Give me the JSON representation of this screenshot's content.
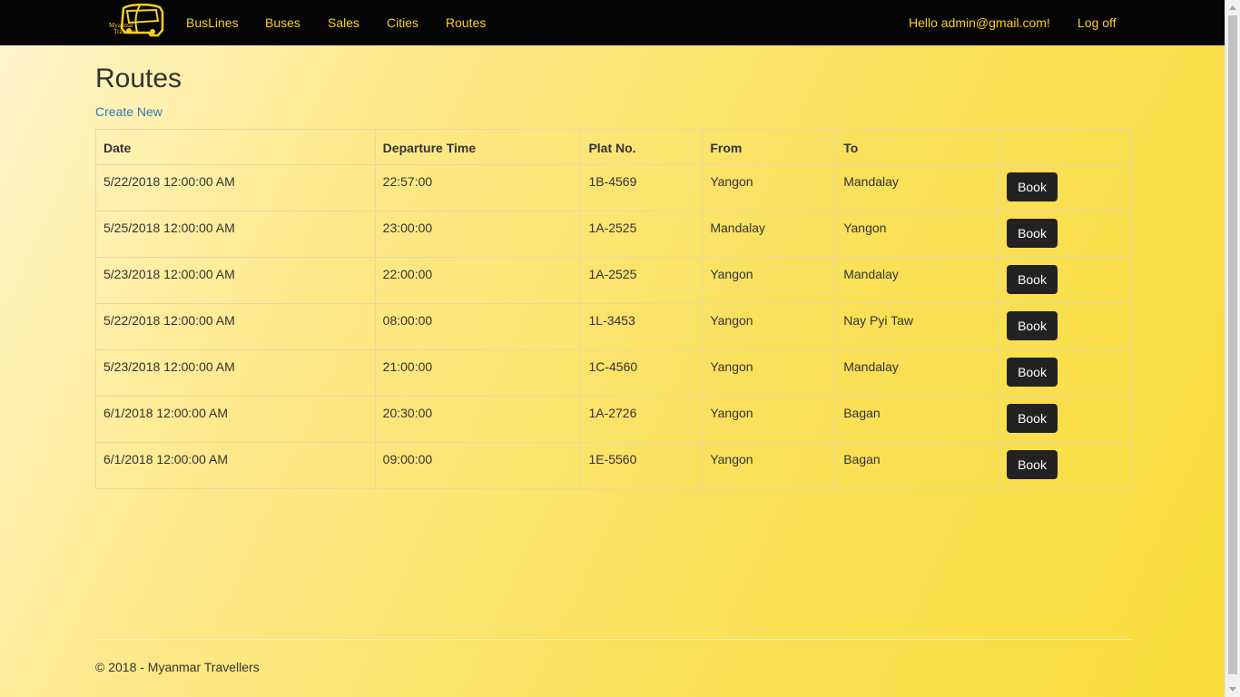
{
  "brand": {
    "logo_line1": "Myanmar",
    "logo_line2": "Travellers"
  },
  "nav": {
    "items": [
      {
        "label": "BusLines"
      },
      {
        "label": "Buses"
      },
      {
        "label": "Sales"
      },
      {
        "label": "Cities"
      },
      {
        "label": "Routes"
      }
    ],
    "greeting": "Hello admin@gmail.com!",
    "logoff": "Log off"
  },
  "page": {
    "title": "Routes",
    "create_new": "Create New"
  },
  "table": {
    "headers": [
      "Date",
      "Departure Time",
      "Plat No.",
      "From",
      "To"
    ],
    "rows": [
      {
        "date": "5/22/2018 12:00:00 AM",
        "departure": "22:57:00",
        "plat": "1B-4569",
        "from": "Yangon",
        "to": "Mandalay",
        "action": "Book"
      },
      {
        "date": "5/25/2018 12:00:00 AM",
        "departure": "23:00:00",
        "plat": "1A-2525",
        "from": "Mandalay",
        "to": "Yangon",
        "action": "Book"
      },
      {
        "date": "5/23/2018 12:00:00 AM",
        "departure": "22:00:00",
        "plat": "1A-2525",
        "from": "Yangon",
        "to": "Mandalay",
        "action": "Book"
      },
      {
        "date": "5/22/2018 12:00:00 AM",
        "departure": "08:00:00",
        "plat": "1L-3453",
        "from": "Yangon",
        "to": "Nay Pyi Taw",
        "action": "Book"
      },
      {
        "date": "5/23/2018 12:00:00 AM",
        "departure": "21:00:00",
        "plat": "1C-4560",
        "from": "Yangon",
        "to": "Mandalay",
        "action": "Book"
      },
      {
        "date": "6/1/2018 12:00:00 AM",
        "departure": "20:30:00",
        "plat": "1A-2726",
        "from": "Yangon",
        "to": "Bagan",
        "action": "Book"
      },
      {
        "date": "6/1/2018 12:00:00 AM",
        "departure": "09:00:00",
        "plat": "1E-5560",
        "from": "Yangon",
        "to": "Bagan",
        "action": "Book"
      }
    ]
  },
  "footer": {
    "text": "© 2018 - Myanmar Travellers"
  },
  "colors": {
    "nav_bg": "#050505",
    "nav_text": "#f8d021",
    "link": "#337ab7",
    "button_bg": "#222222",
    "page_accent": "#fbe05c"
  }
}
